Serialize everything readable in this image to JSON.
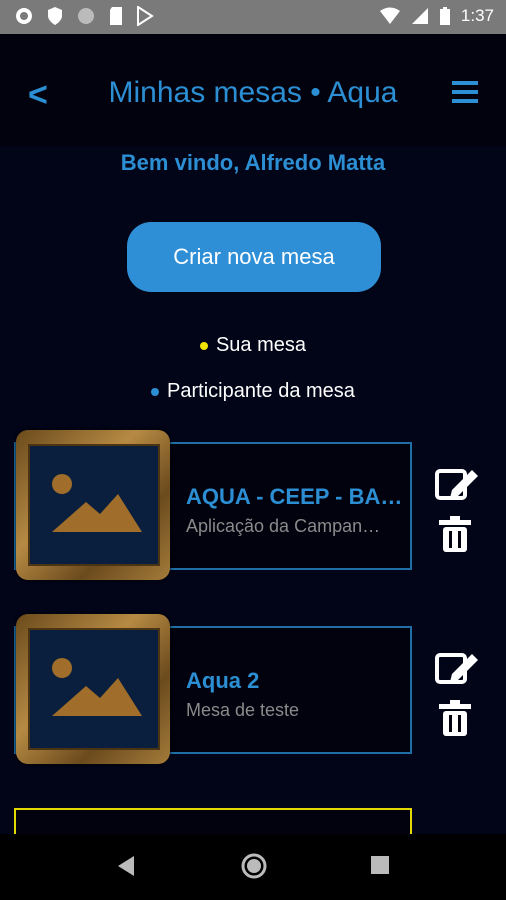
{
  "status": {
    "time": "1:37"
  },
  "header": {
    "back_label": "<",
    "title": "Minhas mesas • Aqua"
  },
  "welcome": "Bem vindo, Alfredo Matta",
  "create_button": "Criar nova mesa",
  "legend": {
    "own": {
      "label": "Sua mesa",
      "color": "#f2e600"
    },
    "participant": {
      "label": "Participante da mesa",
      "color": "#2c8fd3"
    }
  },
  "tables": [
    {
      "name": "AQUA - CEEP - BA…",
      "description": "Aplicação da Campan…",
      "type": "participant"
    },
    {
      "name": "Aqua 2",
      "description": "Mesa de teste",
      "type": "participant"
    },
    {
      "name": "",
      "description": "",
      "type": "own"
    }
  ],
  "icons": {
    "edit": "edit-icon",
    "delete": "trash-icon",
    "menu": "hamburger-menu-icon",
    "placeholder": "image-placeholder-icon"
  }
}
